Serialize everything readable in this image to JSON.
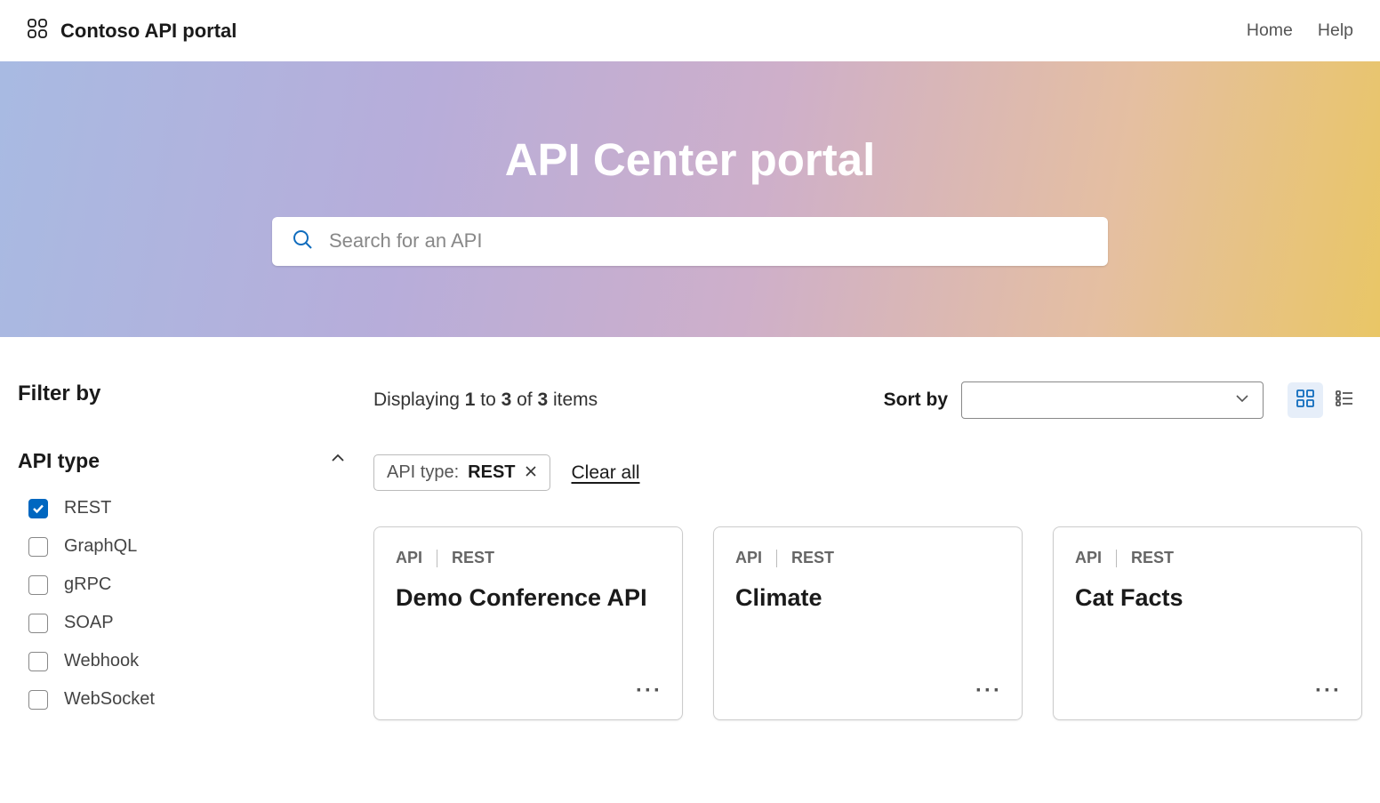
{
  "nav": {
    "brand": "Contoso API portal",
    "links": [
      "Home",
      "Help"
    ]
  },
  "hero": {
    "title": "API Center portal",
    "search_placeholder": "Search for an API"
  },
  "sidebar": {
    "heading": "Filter by",
    "group_title": "API type",
    "options": [
      {
        "label": "REST",
        "checked": true
      },
      {
        "label": "GraphQL",
        "checked": false
      },
      {
        "label": "gRPC",
        "checked": false
      },
      {
        "label": "SOAP",
        "checked": false
      },
      {
        "label": "Webhook",
        "checked": false
      },
      {
        "label": "WebSocket",
        "checked": false
      }
    ]
  },
  "results": {
    "prefix": "Displaying ",
    "from": "1",
    "mid1": " to ",
    "to": "3",
    "mid2": " of ",
    "total": "3",
    "suffix": " items",
    "sort_label": "Sort by"
  },
  "chips": {
    "items": [
      {
        "key": "API type: ",
        "value": "REST"
      }
    ],
    "clear": "Clear all"
  },
  "cards": [
    {
      "tag1": "API",
      "tag2": "REST",
      "title": "Demo Conference API"
    },
    {
      "tag1": "API",
      "tag2": "REST",
      "title": "Climate"
    },
    {
      "tag1": "API",
      "tag2": "REST",
      "title": "Cat Facts"
    }
  ]
}
